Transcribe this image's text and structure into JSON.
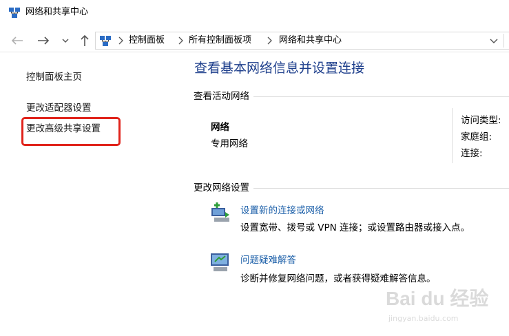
{
  "window": {
    "title": "网络和共享中心"
  },
  "breadcrumb": {
    "items": [
      "控制面板",
      "所有控制面板项",
      "网络和共享中心"
    ]
  },
  "sidebar": {
    "items": [
      {
        "label": "控制面板主页"
      },
      {
        "label": "更改适配器设置"
      },
      {
        "label": "更改高级共享设置"
      }
    ]
  },
  "main": {
    "heading": "查看基本网络信息并设置连接",
    "active_networks": {
      "title": "查看活动网络",
      "network_name": "网络",
      "network_type": "专用网络",
      "access_type_label": "访问类型:",
      "homegroup_label": "家庭组:",
      "connections_label": "连接:"
    },
    "change_settings": {
      "title": "更改网络设置",
      "tasks": [
        {
          "link": "设置新的连接或网络",
          "desc": "设置宽带、拨号或 VPN 连接；或设置路由器或接入点。",
          "icon": "new-connection-icon"
        },
        {
          "link": "问题疑难解答",
          "desc": "诊断并修复网络问题，或者获得疑难解答信息。",
          "icon": "troubleshoot-icon"
        }
      ]
    }
  },
  "watermark": {
    "text": "Bai du 经验",
    "sub": "jingyan.baidu.com"
  },
  "colors": {
    "heading": "#1e3f8c",
    "link": "#1a5ea8",
    "highlight": "#e0231b"
  }
}
